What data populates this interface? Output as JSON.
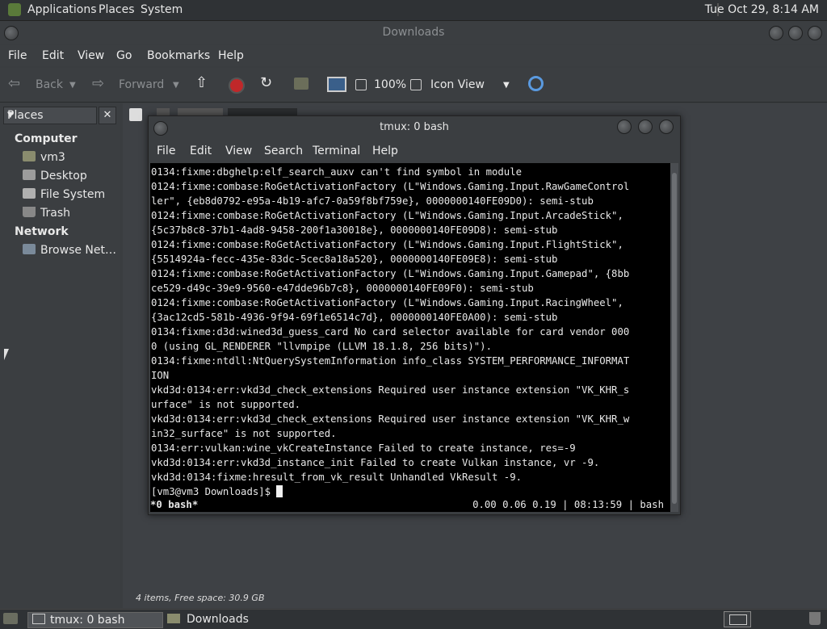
{
  "top_panel": {
    "menus": [
      "Applications",
      "Places",
      "System"
    ],
    "clock": "Tue Oct 29,  8:14 AM"
  },
  "file_manager": {
    "title": "Downloads",
    "menu": [
      "File",
      "Edit",
      "View",
      "Go",
      "Bookmarks",
      "Help"
    ],
    "toolbar": {
      "back": "Back",
      "forward": "Forward",
      "zoom": "100%",
      "view_mode": "Icon View"
    },
    "sidebar": {
      "selector": "Places",
      "close": "✕",
      "sections": [
        {
          "heading": "Computer",
          "items": [
            "vm3",
            "Desktop",
            "File System",
            "Trash"
          ]
        },
        {
          "heading": "Network",
          "items": [
            "Browse Net…"
          ]
        }
      ]
    },
    "status": "4 items, Free space: 30.9 GB"
  },
  "terminal": {
    "title": "tmux: 0 bash",
    "menu": [
      "File",
      "Edit",
      "View",
      "Search",
      "Terminal",
      "Help"
    ],
    "lines": [
      "0134:fixme:dbghelp:elf_search_auxv can't find symbol in module",
      "0124:fixme:combase:RoGetActivationFactory (L\"Windows.Gaming.Input.RawGameControl",
      "ler\", {eb8d0792-e95a-4b19-afc7-0a59f8bf759e}, 0000000140FE09D0): semi-stub",
      "0124:fixme:combase:RoGetActivationFactory (L\"Windows.Gaming.Input.ArcadeStick\",",
      "{5c37b8c8-37b1-4ad8-9458-200f1a30018e}, 0000000140FE09D8): semi-stub",
      "0124:fixme:combase:RoGetActivationFactory (L\"Windows.Gaming.Input.FlightStick\",",
      "{5514924a-fecc-435e-83dc-5cec8a18a520}, 0000000140FE09E8): semi-stub",
      "0124:fixme:combase:RoGetActivationFactory (L\"Windows.Gaming.Input.Gamepad\", {8bb",
      "ce529-d49c-39e9-9560-e47dde96b7c8}, 0000000140FE09F0): semi-stub",
      "0124:fixme:combase:RoGetActivationFactory (L\"Windows.Gaming.Input.RacingWheel\",",
      "{3ac12cd5-581b-4936-9f94-69f1e6514c7d}, 0000000140FE0A00): semi-stub",
      "0134:fixme:d3d:wined3d_guess_card No card selector available for card vendor 000",
      "0 (using GL_RENDERER \"llvmpipe (LLVM 18.1.8, 256 bits)\").",
      "0134:fixme:ntdll:NtQuerySystemInformation info_class SYSTEM_PERFORMANCE_INFORMAT",
      "ION",
      "vkd3d:0134:err:vkd3d_check_extensions Required user instance extension \"VK_KHR_s",
      "urface\" is not supported.",
      "vkd3d:0134:err:vkd3d_check_extensions Required user instance extension \"VK_KHR_w",
      "in32_surface\" is not supported.",
      "0134:err:vulkan:wine_vkCreateInstance Failed to create instance, res=-9",
      "vkd3d:0134:err:vkd3d_instance_init Failed to create Vulkan instance, vr -9.",
      "vkd3d:0134:fixme:hresult_from_vk_result Unhandled VkResult -9."
    ],
    "prompt": "[vm3@vm3 Downloads]$ ",
    "tmux_window": " *0 bash*",
    "tmux_right": "0.00 0.06 0.19 | 08:13:59 | bash "
  },
  "taskbar": {
    "tasks": [
      "tmux: 0 bash",
      "Downloads"
    ]
  }
}
